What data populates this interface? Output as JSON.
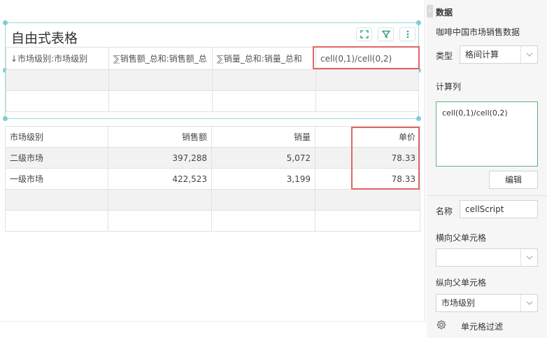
{
  "widget": {
    "title": "自由式表格",
    "headers": [
      "↓市场级别:市场级别",
      "⅀销售额_总和:销售额_总",
      "⅀销量_总和:销量_总和",
      "cell(0,1)/cell(0,2)"
    ]
  },
  "result_table": {
    "headers": [
      "市场级别",
      "销售额",
      "销量",
      "单价"
    ],
    "rows": [
      [
        "二级市场",
        "397,288",
        "5,072",
        "78.33"
      ],
      [
        "一级市场",
        "422,523",
        "3,199",
        "78.33"
      ]
    ]
  },
  "panel": {
    "collapse_glyph": "›",
    "title": "数据",
    "dataset": "咖啡中国市场销售数据",
    "type_label": "类型",
    "type_value": "格间计算",
    "calc_label": "计算列",
    "formula": "cell(0,1)/cell(0,2)",
    "edit_label": "编辑",
    "name_label": "名称",
    "name_value": "cellScript",
    "h_parent_label": "横向父单元格",
    "h_parent_value": "",
    "v_parent_label": "纵向父单元格",
    "v_parent_value": "市场级别",
    "filter_label": "单元格过滤"
  },
  "icons": {
    "fullscreen": "fullscreen-icon",
    "filter": "filter-icon",
    "more": "more-vertical-icon",
    "chevron": "chevron-down-icon",
    "gear": "gear-icon"
  },
  "colors": {
    "accent_teal": "#7fcdd3",
    "highlight_red": "#e06666",
    "formula_border": "#5fb27a"
  }
}
